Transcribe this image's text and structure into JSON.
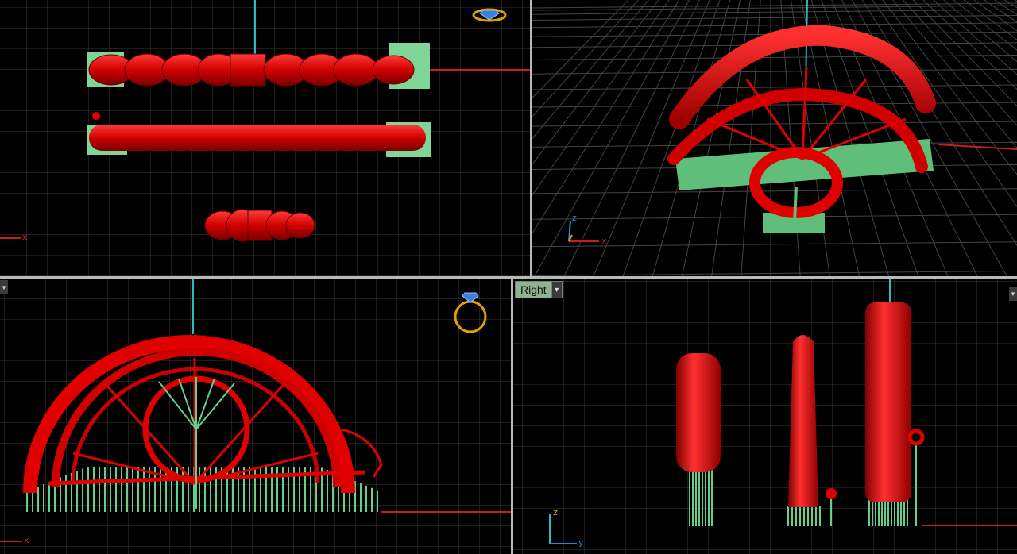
{
  "viewports": {
    "top": {
      "label": ""
    },
    "perspective": {
      "label": ""
    },
    "front": {
      "label": ""
    },
    "right": {
      "label": "Right"
    }
  },
  "axes": {
    "x": "x",
    "y": "y",
    "z": "z"
  },
  "colors": {
    "background": "#000000",
    "grid_minor": "#3a3a3a",
    "grid_major": "#7a7a7a",
    "model": "#e00000",
    "supports": "#66d08a",
    "x_axis": "#c81e1e",
    "y_axis": "#1f8fd0",
    "z_axis": "#2bbbbb"
  },
  "icons": [
    "ring-gizmo-icon",
    "dropdown-arrow-icon"
  ]
}
